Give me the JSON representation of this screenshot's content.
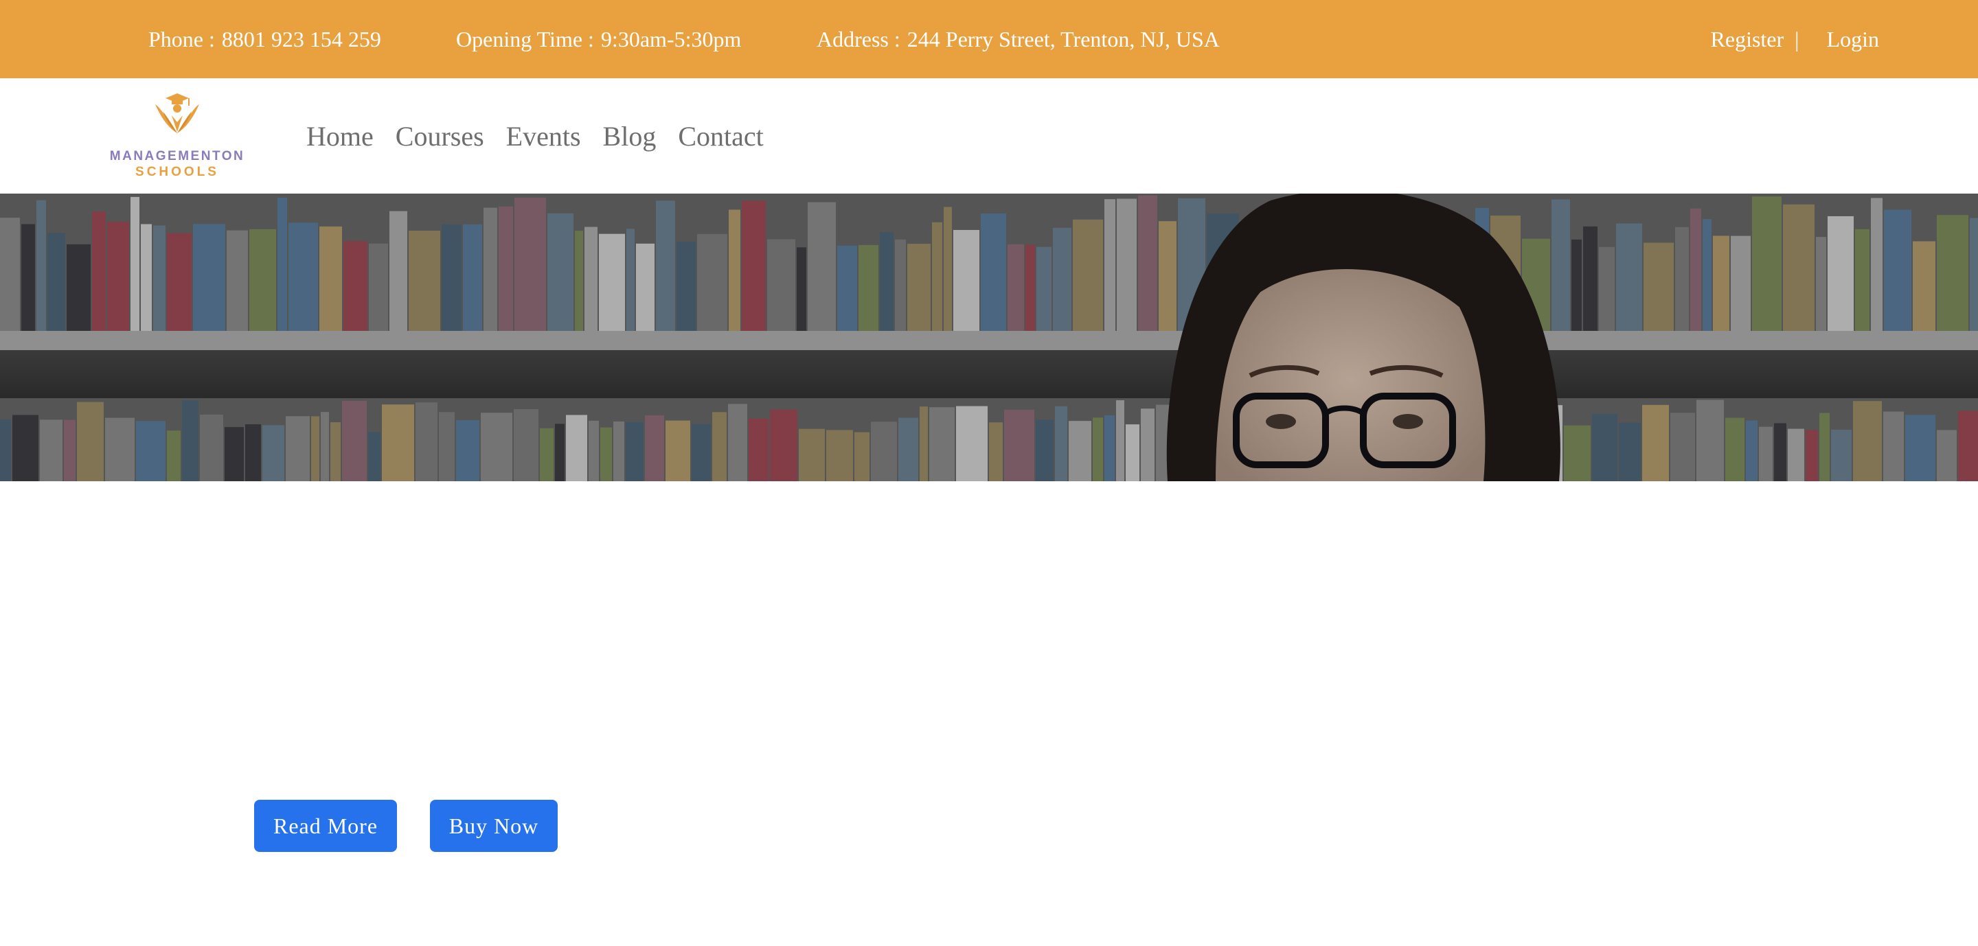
{
  "topbar": {
    "phone": {
      "label": "Phone :",
      "value": "8801 923 154 259"
    },
    "hours": {
      "label": "Opening Time :",
      "value": "9:30am-5:30pm"
    },
    "address": {
      "label": "Address :",
      "value": "244 Perry Street, Trenton, NJ, USA"
    },
    "register": "Register",
    "separator": "|",
    "login": "Login"
  },
  "logo": {
    "line1": "MANAGEMENTON",
    "line2": "SCHOOLS"
  },
  "nav": {
    "items": [
      "Home",
      "Courses",
      "Events",
      "Blog",
      "Contact"
    ]
  },
  "hero": {
    "image": "library-bookshelves-woman-with-glasses"
  },
  "buttons": {
    "read_more": "Read More",
    "buy_now": "Buy Now"
  },
  "colors": {
    "topbar": "#e9a03e",
    "logo_purple": "#8a7bbd",
    "logo_orange": "#e9a03e",
    "nav_text": "#6e6e6e",
    "button": "#2672ed"
  }
}
